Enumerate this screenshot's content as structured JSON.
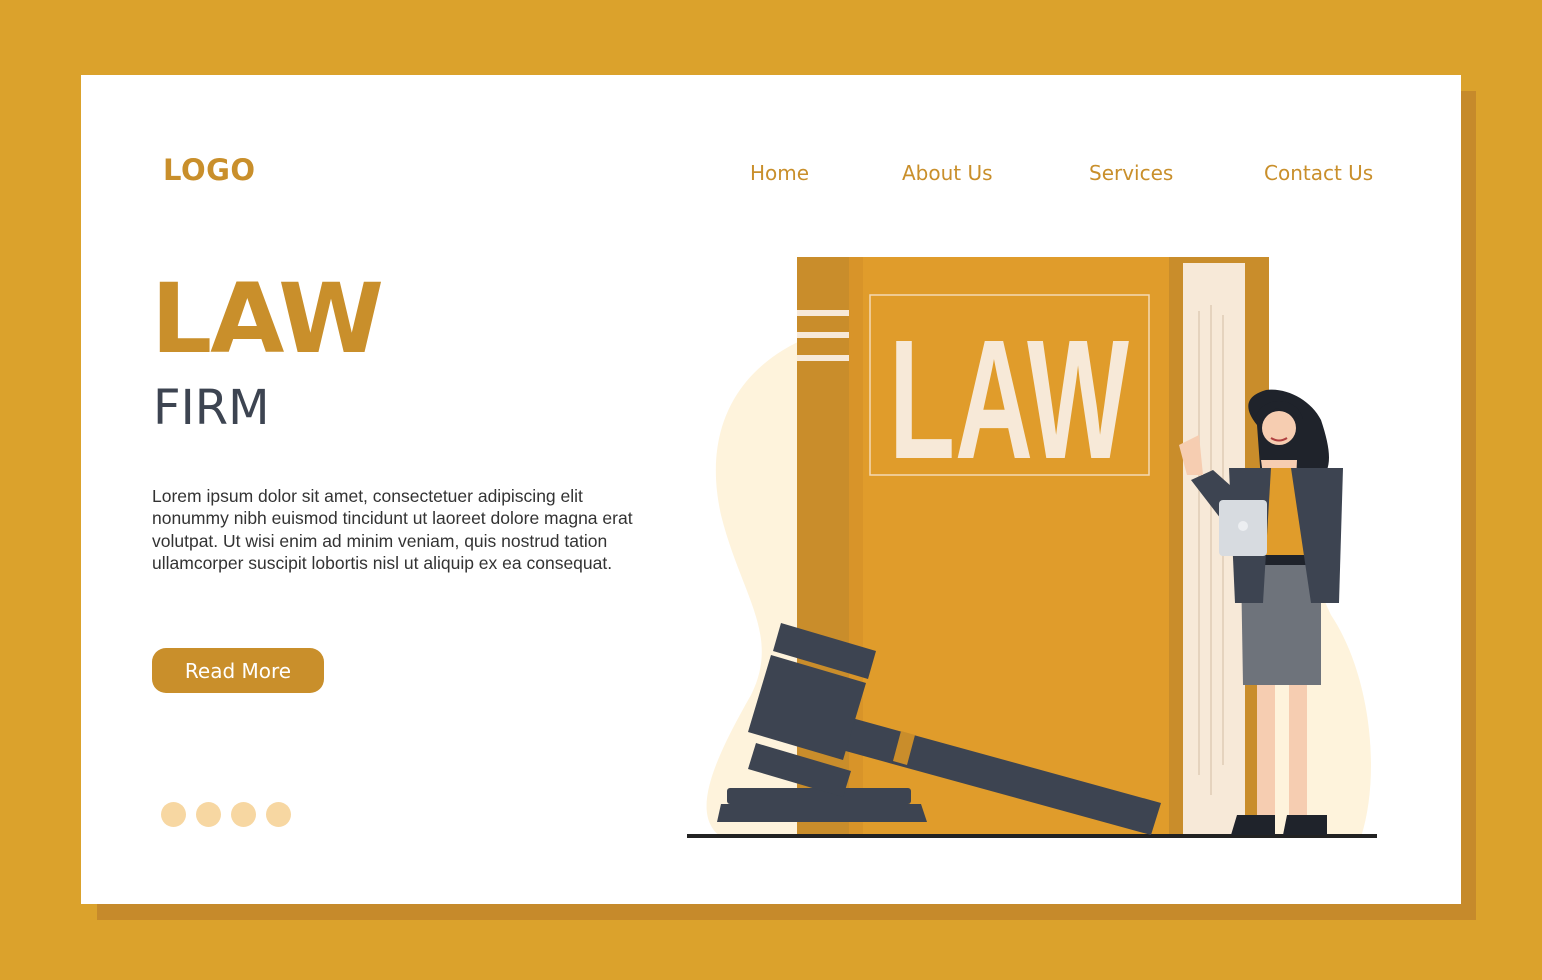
{
  "header": {
    "logo": "LOGO",
    "nav": [
      {
        "label": "Home"
      },
      {
        "label": "About Us"
      },
      {
        "label": "Services"
      },
      {
        "label": "Contact Us"
      }
    ]
  },
  "hero": {
    "title": "LAW",
    "subtitle": "FIRM",
    "body": "Lorem ipsum dolor sit amet, consectetuer adipiscing elit nonummy nibh euismod tincidunt ut laoreet dolore magna erat volutpat. Ut wisi enim ad minim veniam, quis nostrud tation ullamcorper suscipit lobortis nisl ut aliquip ex ea consequat.",
    "button_label": "Read More",
    "pagination_dots": 4
  },
  "illustration": {
    "book_title": "LAW",
    "items": [
      "law-book-icon",
      "gavel-icon",
      "lawyer-woman-icon",
      "tablet-icon"
    ]
  },
  "colors": {
    "background": "#DBA22C",
    "card": "#FFFFFF",
    "accent": "#C98F2B",
    "book": "#E09C2B",
    "dark": "#3D4451",
    "dot": "#F7D7A2"
  }
}
